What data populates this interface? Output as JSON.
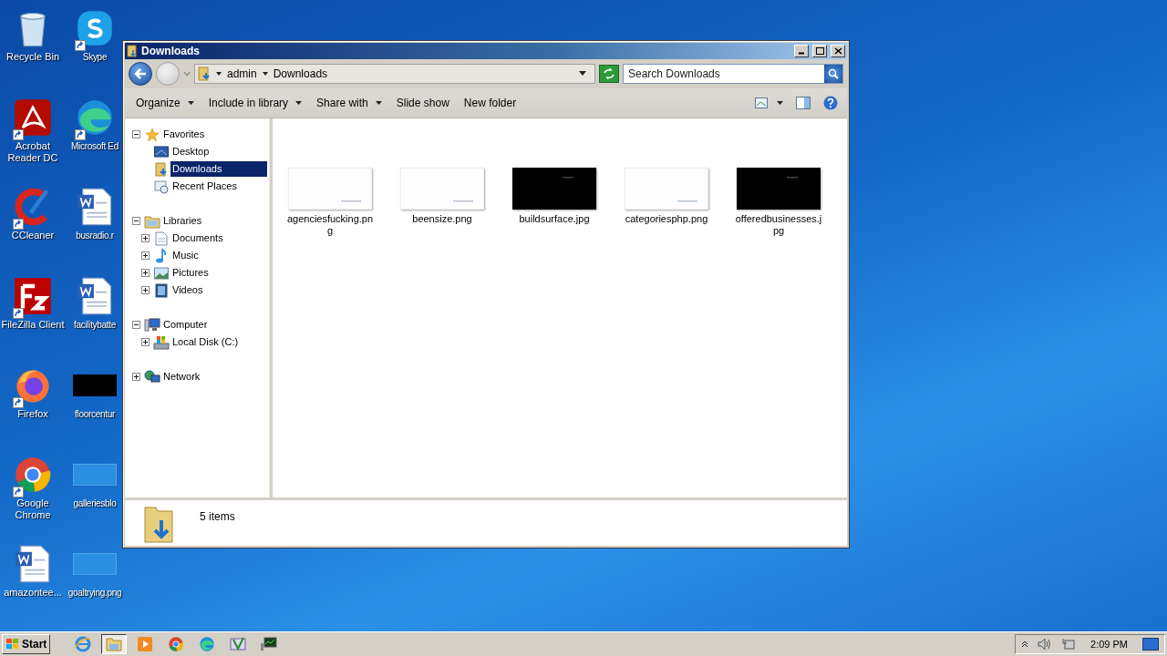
{
  "desktop_icons": [
    {
      "label": "Recycle Bin",
      "kind": "recycle"
    },
    {
      "label": "Skype",
      "kind": "skype"
    },
    {
      "label": "Acrobat Reader DC",
      "kind": "acrobat"
    },
    {
      "label": "Microsoft Ed",
      "kind": "edge"
    },
    {
      "label": "CCleaner",
      "kind": "ccleaner"
    },
    {
      "label": "busradio.r",
      "kind": "word"
    },
    {
      "label": "FileZilla Client",
      "kind": "filezilla"
    },
    {
      "label": "facilitybatte",
      "kind": "word"
    },
    {
      "label": "Firefox",
      "kind": "firefox"
    },
    {
      "label": "floorcentur",
      "kind": "dark"
    },
    {
      "label": "Google Chrome",
      "kind": "chrome"
    },
    {
      "label": "galleriesblo",
      "kind": "blank"
    },
    {
      "label": "amazontee...",
      "kind": "word"
    },
    {
      "label": "goaltrying.png",
      "kind": "blank"
    }
  ],
  "window": {
    "title": "Downloads",
    "breadcrumb": [
      "admin",
      "Downloads"
    ],
    "search": {
      "placeholder": "Search Downloads"
    },
    "toolbar": [
      {
        "label": "Organize",
        "dropdown": true
      },
      {
        "label": "Include in library",
        "dropdown": true
      },
      {
        "label": "Share with",
        "dropdown": true
      },
      {
        "label": "Slide show",
        "dropdown": false
      },
      {
        "label": "New folder",
        "dropdown": false
      }
    ],
    "nav": [
      {
        "label": "Favorites",
        "expanded": true,
        "selected": false,
        "children": [
          {
            "label": "Desktop",
            "selected": false
          },
          {
            "label": "Downloads",
            "selected": true
          },
          {
            "label": "Recent Places",
            "selected": false
          }
        ]
      },
      {
        "label": "Libraries",
        "expanded": true,
        "selected": false,
        "children": [
          {
            "label": "Documents",
            "expanded": false,
            "selected": false
          },
          {
            "label": "Music",
            "expanded": false,
            "selected": false
          },
          {
            "label": "Pictures",
            "expanded": false,
            "selected": false
          },
          {
            "label": "Videos",
            "expanded": false,
            "selected": false
          }
        ]
      },
      {
        "label": "Computer",
        "expanded": true,
        "selected": false,
        "children": [
          {
            "label": "Local Disk (C:)",
            "expanded": false,
            "selected": false
          }
        ]
      },
      {
        "label": "Network",
        "expanded": false,
        "selected": false
      }
    ],
    "files": [
      {
        "name": "agenciesfucking.png",
        "kind": "light"
      },
      {
        "name": "beensize.png",
        "kind": "light"
      },
      {
        "name": "buildsurface.jpg",
        "kind": "dark"
      },
      {
        "name": "categoriesphp.png",
        "kind": "light"
      },
      {
        "name": "offeredbusinesses.jpg",
        "kind": "dark"
      }
    ],
    "details": {
      "count": "5 items"
    }
  },
  "taskbar": {
    "start": "Start",
    "apps": [
      {
        "kind": "ie",
        "selected": false
      },
      {
        "kind": "explorer",
        "selected": true
      },
      {
        "kind": "media",
        "selected": false
      },
      {
        "kind": "chrome",
        "selected": false
      },
      {
        "kind": "edge",
        "selected": false
      },
      {
        "kind": "tool",
        "selected": false
      },
      {
        "kind": "monitor",
        "selected": false
      }
    ],
    "clock": "2:09 PM"
  }
}
